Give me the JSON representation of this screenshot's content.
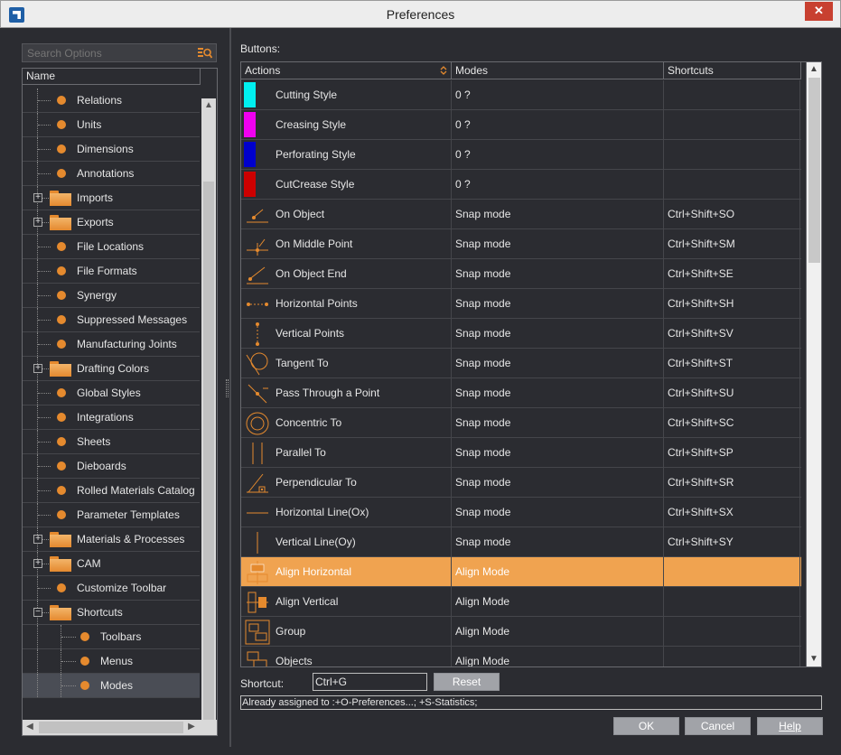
{
  "window": {
    "title": "Preferences",
    "close_label": "✕"
  },
  "search": {
    "placeholder": "Search Options"
  },
  "tree": {
    "header": "Name",
    "items": [
      {
        "label": "Relations",
        "kind": "leaf"
      },
      {
        "label": "Units",
        "kind": "leaf"
      },
      {
        "label": "Dimensions",
        "kind": "leaf"
      },
      {
        "label": "Annotations",
        "kind": "leaf"
      },
      {
        "label": "Imports",
        "kind": "folder"
      },
      {
        "label": "Exports",
        "kind": "folder"
      },
      {
        "label": "File Locations",
        "kind": "leaf"
      },
      {
        "label": "File Formats",
        "kind": "leaf"
      },
      {
        "label": "Synergy",
        "kind": "leaf"
      },
      {
        "label": "Suppressed Messages",
        "kind": "leaf"
      },
      {
        "label": "Manufacturing Joints",
        "kind": "leaf"
      },
      {
        "label": "Drafting Colors",
        "kind": "folder"
      },
      {
        "label": "Global Styles",
        "kind": "leaf"
      },
      {
        "label": "Integrations",
        "kind": "leaf"
      },
      {
        "label": "Sheets",
        "kind": "leaf"
      },
      {
        "label": "Dieboards",
        "kind": "leaf"
      },
      {
        "label": "Rolled Materials Catalog",
        "kind": "leaf"
      },
      {
        "label": "Parameter Templates",
        "kind": "leaf"
      },
      {
        "label": "Materials & Processes",
        "kind": "folder"
      },
      {
        "label": "CAM",
        "kind": "folder"
      },
      {
        "label": "Customize Toolbar",
        "kind": "leaf"
      },
      {
        "label": "Shortcuts",
        "kind": "folder-open"
      },
      {
        "label": "Toolbars",
        "kind": "child"
      },
      {
        "label": "Menus",
        "kind": "child"
      },
      {
        "label": "Modes",
        "kind": "child",
        "selected": true
      }
    ]
  },
  "buttons_label": "Buttons:",
  "grid": {
    "columns": [
      "Actions",
      "Modes",
      "Shortcuts"
    ],
    "rows": [
      {
        "action": "Cutting Style",
        "mode": "0 ?",
        "shortcut": "",
        "swatch": "#00f0f0"
      },
      {
        "action": "Creasing Style",
        "mode": "0 ?",
        "shortcut": "",
        "swatch": "#f000f0"
      },
      {
        "action": "Perforating Style",
        "mode": "0 ?",
        "shortcut": "",
        "swatch": "#0000cc"
      },
      {
        "action": "CutCrease Style",
        "mode": "0 ?",
        "shortcut": "",
        "swatch": "#cc0000"
      },
      {
        "action": "On Object",
        "mode": "Snap mode",
        "shortcut": "Ctrl+Shift+SO",
        "icon": "on-object-icon"
      },
      {
        "action": "On Middle Point",
        "mode": "Snap mode",
        "shortcut": "Ctrl+Shift+SM",
        "icon": "middle-point-icon"
      },
      {
        "action": "On Object End",
        "mode": "Snap mode",
        "shortcut": "Ctrl+Shift+SE",
        "icon": "object-end-icon"
      },
      {
        "action": "Horizontal Points",
        "mode": "Snap mode",
        "shortcut": "Ctrl+Shift+SH",
        "icon": "horizontal-points-icon"
      },
      {
        "action": "Vertical Points",
        "mode": "Snap mode",
        "shortcut": "Ctrl+Shift+SV",
        "icon": "vertical-points-icon"
      },
      {
        "action": "Tangent To",
        "mode": "Snap mode",
        "shortcut": "Ctrl+Shift+ST",
        "icon": "tangent-icon"
      },
      {
        "action": "Pass Through a Point",
        "mode": "Snap mode",
        "shortcut": "Ctrl+Shift+SU",
        "icon": "pass-through-icon"
      },
      {
        "action": "Concentric To",
        "mode": "Snap mode",
        "shortcut": "Ctrl+Shift+SC",
        "icon": "concentric-icon"
      },
      {
        "action": "Parallel To",
        "mode": "Snap mode",
        "shortcut": "Ctrl+Shift+SP",
        "icon": "parallel-icon"
      },
      {
        "action": "Perpendicular To",
        "mode": "Snap mode",
        "shortcut": "Ctrl+Shift+SR",
        "icon": "perpendicular-icon"
      },
      {
        "action": "Horizontal Line(Ox)",
        "mode": "Snap mode",
        "shortcut": "Ctrl+Shift+SX",
        "icon": "horizontal-line-icon"
      },
      {
        "action": "Vertical Line(Oy)",
        "mode": "Snap mode",
        "shortcut": "Ctrl+Shift+SY",
        "icon": "vertical-line-icon"
      },
      {
        "action": "Align Horizontal",
        "mode": "Align Mode",
        "shortcut": "",
        "icon": "align-horizontal-icon",
        "selected": true
      },
      {
        "action": "Align Vertical",
        "mode": "Align Mode",
        "shortcut": "",
        "icon": "align-vertical-icon"
      },
      {
        "action": "Group",
        "mode": "Align Mode",
        "shortcut": "",
        "icon": "group-icon"
      },
      {
        "action": "Objects",
        "mode": "Align Mode",
        "shortcut": "",
        "icon": "objects-icon"
      }
    ]
  },
  "shortcut": {
    "label": "Shortcut:",
    "value": "Ctrl+G",
    "reset_label": "Reset"
  },
  "assigned_text": "Already assigned to :+O-Preferences...; +S-Statistics;",
  "footer": {
    "ok": "OK",
    "cancel": "Cancel",
    "help": "Help"
  },
  "colors": {
    "accent": "#e58a2e",
    "highlight_row": "#f0a350",
    "background": "#2b2c31"
  }
}
